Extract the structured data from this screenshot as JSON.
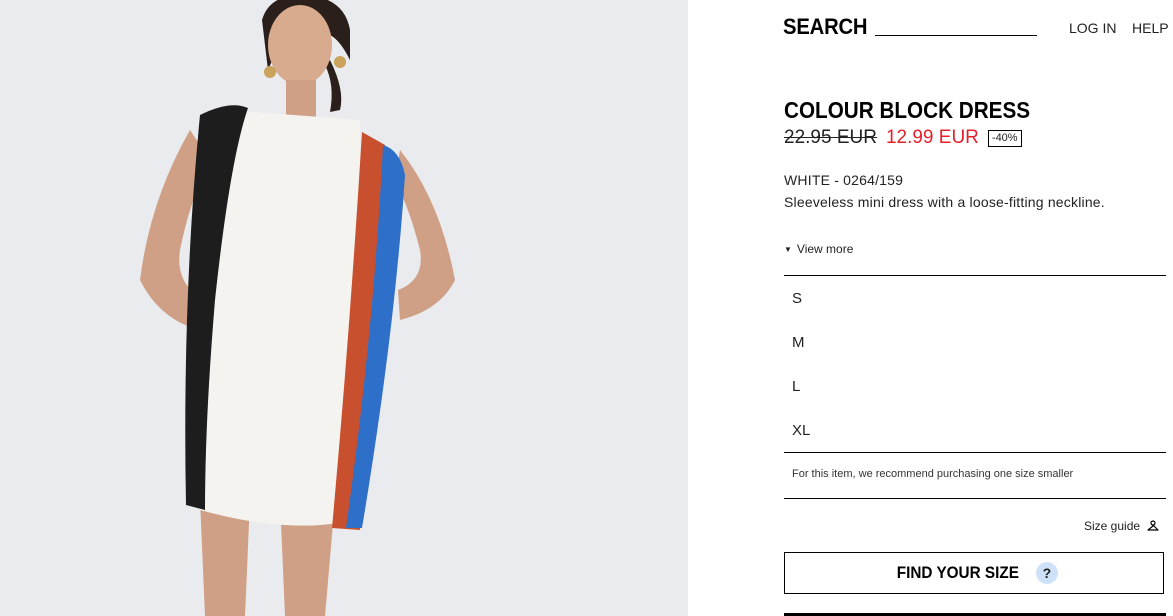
{
  "header": {
    "search_label": "SEARCH",
    "login_label": "LOG IN",
    "help_label": "HELP"
  },
  "product": {
    "name": "COLOUR BLOCK DRESS",
    "old_price": "22.95 EUR",
    "new_price": "12.99 EUR",
    "discount": "-40%",
    "color_ref": "WHITE - 0264/159",
    "description": "Sleeveless mini dress with a loose-fitting neckline.",
    "view_more": "View more"
  },
  "sizes": [
    "S",
    "M",
    "L",
    "XL"
  ],
  "size_note": "For this item, we recommend purchasing one size smaller",
  "size_guide_label": "Size guide",
  "find_size_label": "FIND YOUR SIZE",
  "find_size_help": "?",
  "colors": {
    "sale_red": "#e4202a",
    "help_badge": "#cfe1f7",
    "photo_bg": "#e9ebee"
  }
}
